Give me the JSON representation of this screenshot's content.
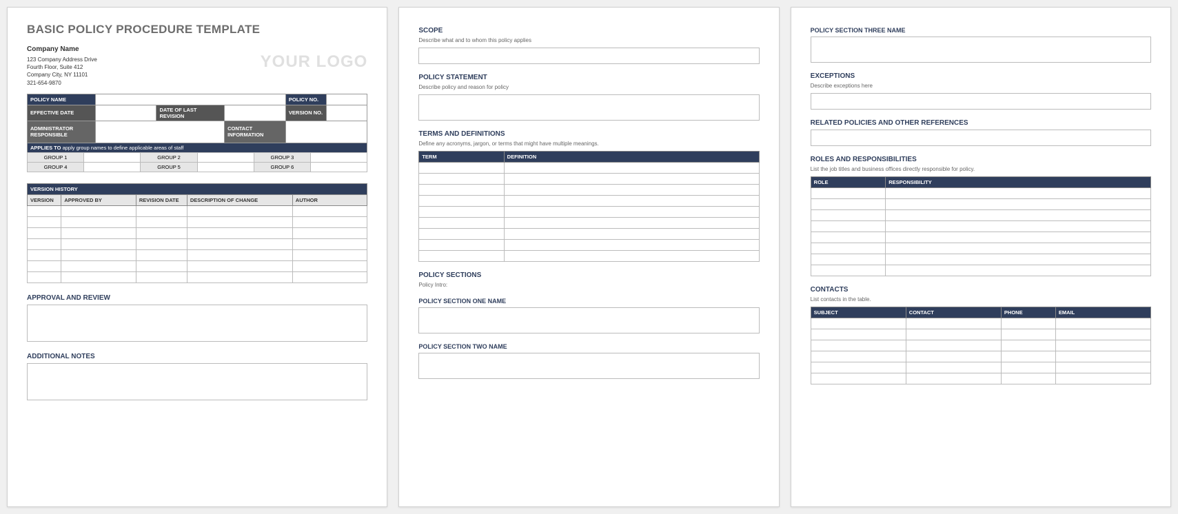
{
  "page1": {
    "title": "BASIC POLICY PROCEDURE TEMPLATE",
    "logo": "YOUR LOGO",
    "company": {
      "name": "Company Name",
      "addr1": "123 Company Address Drive",
      "addr2": "Fourth Floor, Suite 412",
      "addr3": "Company City, NY  11101",
      "phone": "321-654-9870"
    },
    "meta": {
      "policy_name_label": "POLICY NAME",
      "policy_no_label": "POLICY NO.",
      "effective_date_label": "EFFECTIVE DATE",
      "date_last_rev_label": "DATE OF LAST REVISION",
      "version_no_label": "VERSION NO.",
      "admin_resp_label_l1": "ADMINISTRATOR",
      "admin_resp_label_l2": "RESPONSIBLE",
      "contact_info_label_l1": "CONTACT",
      "contact_info_label_l2": "INFORMATION"
    },
    "applies": {
      "label": "APPLIES TO",
      "hint": "apply group names to define applicable areas of staff",
      "g1": "GROUP 1",
      "g2": "GROUP 2",
      "g3": "GROUP 3",
      "g4": "GROUP 4",
      "g5": "GROUP 5",
      "g6": "GROUP 6"
    },
    "version_history": {
      "heading": "VERSION HISTORY",
      "cols": {
        "version": "VERSION",
        "approved_by": "APPROVED BY",
        "revision_date": "REVISION DATE",
        "description": "DESCRIPTION OF CHANGE",
        "author": "AUTHOR"
      }
    },
    "approval_review_heading": "APPROVAL AND REVIEW",
    "additional_notes_heading": "ADDITIONAL NOTES"
  },
  "page2": {
    "scope": {
      "heading": "SCOPE",
      "hint": "Describe what and to whom this policy applies"
    },
    "policy_statement": {
      "heading": "POLICY STATEMENT",
      "hint": "Describe policy and reason for policy"
    },
    "terms": {
      "heading": "TERMS AND DEFINITIONS",
      "hint": "Define any acronyms, jargon, or terms that might have multiple meanings.",
      "col_term": "TERM",
      "col_def": "DEFINITION"
    },
    "policy_sections": {
      "heading": "POLICY SECTIONS",
      "intro": "Policy Intro:",
      "one": "POLICY SECTION ONE NAME",
      "two": "POLICY SECTION TWO NAME"
    }
  },
  "page3": {
    "section_three": "POLICY SECTION THREE NAME",
    "exceptions": {
      "heading": "EXCEPTIONS",
      "hint": "Describe exceptions here"
    },
    "related": "RELATED POLICIES AND OTHER REFERENCES",
    "roles": {
      "heading": "ROLES AND RESPONSIBILITIES",
      "hint": "List the job titles and business offices directly responsible for policy.",
      "col_role": "ROLE",
      "col_resp": "RESPONSIBILITY"
    },
    "contacts": {
      "heading": "CONTACTS",
      "hint": "List contacts in the table.",
      "col_subject": "SUBJECT",
      "col_contact": "CONTACT",
      "col_phone": "PHONE",
      "col_email": "EMAIL"
    }
  }
}
